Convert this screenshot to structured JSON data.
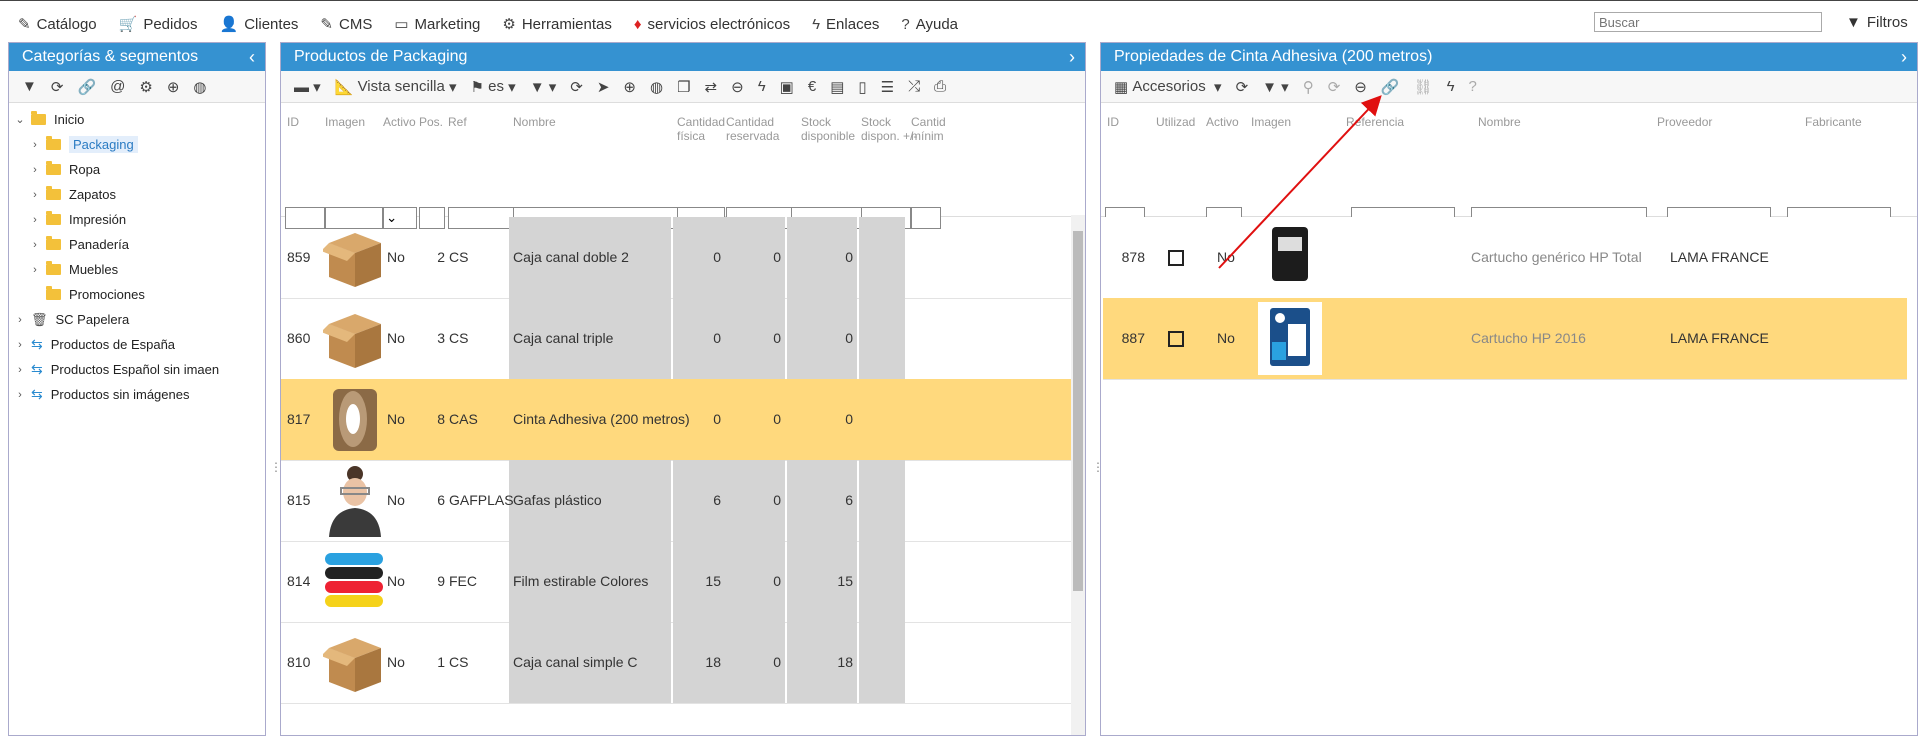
{
  "menu": [
    {
      "icon": "edit-icon",
      "glyph": "✎",
      "label": "Catálogo"
    },
    {
      "icon": "cart-icon",
      "glyph": "🛒",
      "label": "Pedidos"
    },
    {
      "icon": "user-icon",
      "glyph": "👤",
      "label": "Clientes"
    },
    {
      "icon": "edit-icon",
      "glyph": "✎",
      "label": "CMS"
    },
    {
      "icon": "screen-icon",
      "glyph": "▭",
      "label": "Marketing"
    },
    {
      "icon": "gear-icon",
      "glyph": "⚙",
      "label": "Herramientas"
    },
    {
      "icon": "gem-icon",
      "glyph": "♦",
      "label": "servicios electrónicos"
    },
    {
      "icon": "bolt-icon",
      "glyph": "ϟ",
      "label": "Enlaces"
    },
    {
      "icon": "help-icon",
      "glyph": "?",
      "label": "Ayuda"
    }
  ],
  "search": {
    "placeholder": "Buscar"
  },
  "filtros": "Filtros",
  "left": {
    "title": "Categorías & segmentos",
    "tree": [
      {
        "label": "Inicio",
        "level": 0,
        "expanded": true,
        "type": "folder"
      },
      {
        "label": "Packaging",
        "level": 1,
        "type": "folder",
        "selected": true
      },
      {
        "label": "Ropa",
        "level": 1,
        "type": "folder"
      },
      {
        "label": "Zapatos",
        "level": 1,
        "type": "folder"
      },
      {
        "label": "Impresión",
        "level": 1,
        "type": "folder"
      },
      {
        "label": "Panadería",
        "level": 1,
        "type": "folder"
      },
      {
        "label": "Muebles",
        "level": 1,
        "type": "folder"
      },
      {
        "label": "Promociones",
        "level": 1,
        "type": "folder",
        "noarrow": true
      },
      {
        "label": "SC Papelera",
        "level": 0,
        "type": "trash"
      },
      {
        "label": "Productos de España",
        "level": 0,
        "type": "segment"
      },
      {
        "label": "Productos Español sin imaen",
        "level": 0,
        "type": "segment"
      },
      {
        "label": "Productos sin imágenes",
        "level": 0,
        "type": "segment"
      }
    ]
  },
  "middle": {
    "title": "Productos de Packaging",
    "view": "Vista sencilla",
    "lang": "es",
    "columns": [
      "ID",
      "Imagen",
      "Activo",
      "Pos.",
      "Ref",
      "Nombre",
      "Cantidad física",
      "Cantidad reservada",
      "Stock disponible",
      "Stock dispon. +/-",
      "Cantid mínim"
    ],
    "rows": [
      {
        "id": "859",
        "activo": "No",
        "pos": "2",
        "ref": "CS",
        "nombre": "Caja canal doble 2",
        "fisica": "0",
        "reservada": "0",
        "stock": "0",
        "img": "box"
      },
      {
        "id": "860",
        "activo": "No",
        "pos": "3",
        "ref": "CS",
        "nombre": "Caja canal triple",
        "fisica": "0",
        "reservada": "0",
        "stock": "0",
        "img": "box"
      },
      {
        "id": "817",
        "activo": "No",
        "pos": "8",
        "ref": "CAS",
        "nombre": "Cinta Adhesiva (200 metros)",
        "fisica": "0",
        "reservada": "0",
        "stock": "0",
        "img": "tape",
        "selected": true
      },
      {
        "id": "815",
        "activo": "No",
        "pos": "6",
        "ref": "GAFPLAS",
        "nombre": "Gafas plástico",
        "fisica": "6",
        "reservada": "0",
        "stock": "6",
        "img": "person"
      },
      {
        "id": "814",
        "activo": "No",
        "pos": "9",
        "ref": "FEC",
        "nombre": "Film estirable Colores",
        "fisica": "15",
        "reservada": "0",
        "stock": "15",
        "img": "film"
      },
      {
        "id": "810",
        "activo": "No",
        "pos": "1",
        "ref": "CS",
        "nombre": "Caja canal simple C",
        "fisica": "18",
        "reservada": "0",
        "stock": "18",
        "img": "box"
      }
    ]
  },
  "right": {
    "title": "Propiedades de Cinta Adhesiva (200 metros)",
    "tab": "Accesorios",
    "columns": [
      "ID",
      "Utilizad",
      "Activo",
      "Imagen",
      "Referencia",
      "Nombre",
      "Proveedor",
      "Fabricante"
    ],
    "rows": [
      {
        "id": "878",
        "activo": "No",
        "nombre": "Cartucho genérico HP Total",
        "proveedor": "LAMA FRANCE",
        "img": "cartridge-black"
      },
      {
        "id": "887",
        "activo": "No",
        "nombre": "Cartucho HP 2016",
        "proveedor": "LAMA FRANCE",
        "img": "cartridge-hp",
        "selected": true
      }
    ]
  },
  "colors": {
    "header": "#3592d1",
    "highlight": "#ffd97d",
    "gray": "#d4d4d4",
    "arrow": "#e01010"
  }
}
